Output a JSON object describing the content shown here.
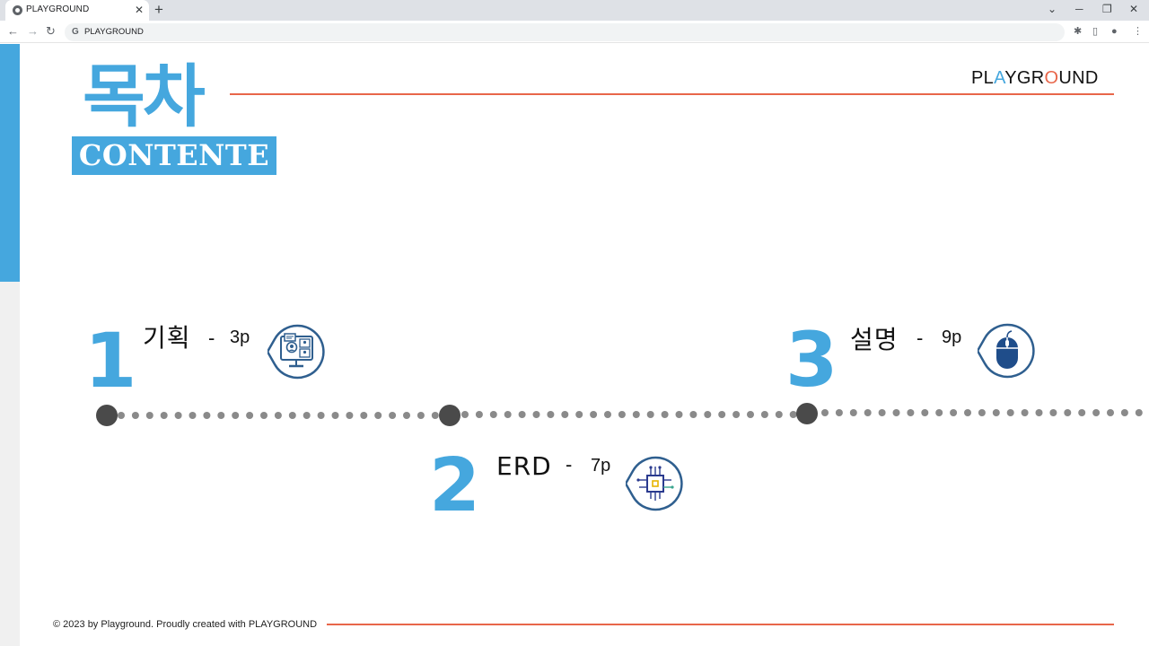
{
  "browser": {
    "tab_title": "PLAYGROUND",
    "tab_close": "✕",
    "new_tab": "+",
    "url": "PLAYGROUND",
    "omnibox_g": "G",
    "back": "←",
    "forward": "→",
    "reload": "↻",
    "win_chevron": "⌄",
    "win_minimize": "─",
    "win_restore": "❐",
    "win_close": "✕",
    "extensions": "✱",
    "sidepanel": "▯",
    "profile": "●",
    "menu": "⋮"
  },
  "header": {
    "title_ko": "목차",
    "title_en": "CONTENTE",
    "brand": {
      "pre": "PL",
      "a": "A",
      "mid": "YGR",
      "o": "O",
      "post": "UND",
      "a_color": "#45a7de",
      "o_color": "#e8664a"
    }
  },
  "toc": [
    {
      "number": "1",
      "label": "기획",
      "dash": "-",
      "page": "3p",
      "icon": "presentation-icon"
    },
    {
      "number": "2",
      "label": "ERD",
      "dash": "-",
      "page": "7p",
      "icon": "circuit-chip-icon"
    },
    {
      "number": "3",
      "label": "설명",
      "dash": "-",
      "page": "9p",
      "icon": "mouse-icon"
    }
  ],
  "footer": {
    "text": "© 2023 by Playground. Proudly created with PLAYGROUND"
  },
  "colors": {
    "accent": "#45a7de",
    "line": "#e8664a",
    "icon": "#2f5f8f",
    "dots": "#8a8a8a",
    "node": "#4a4a4a"
  }
}
